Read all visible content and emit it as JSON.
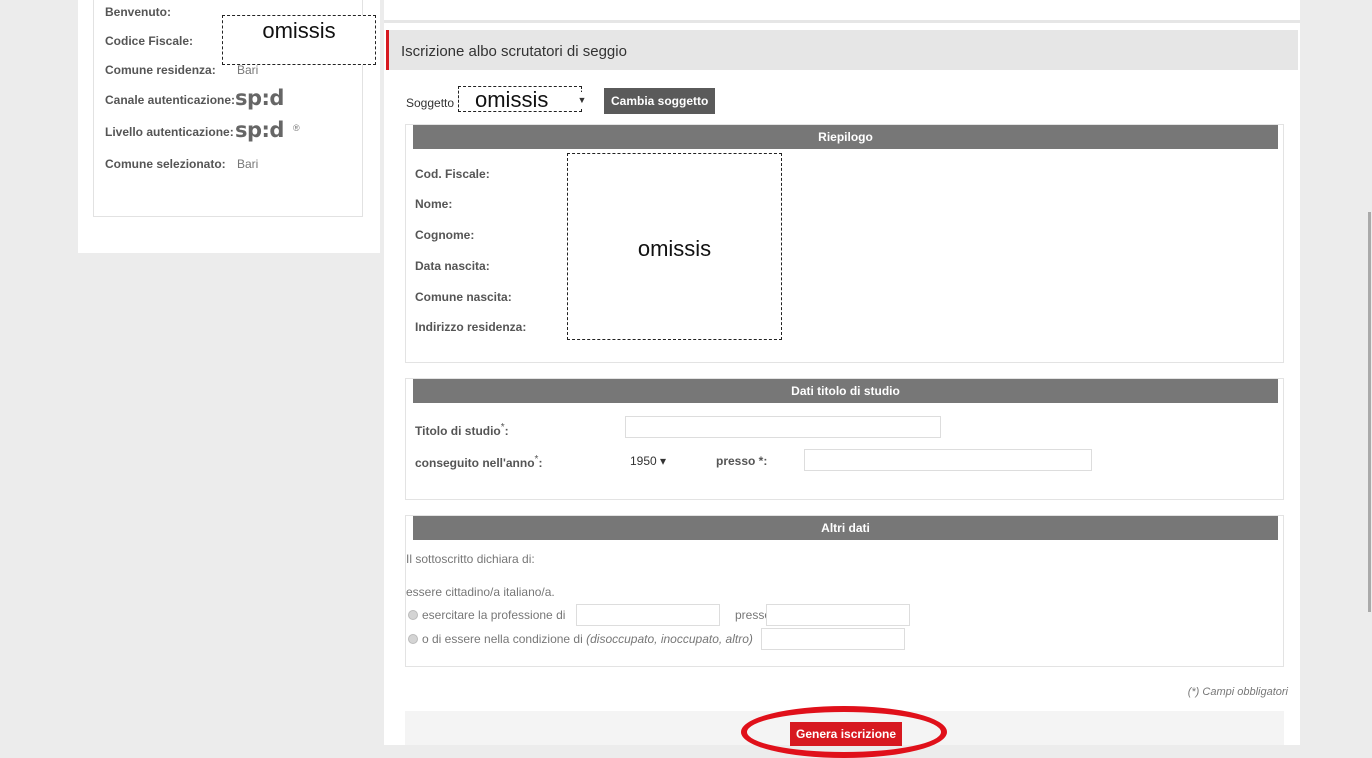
{
  "user_panel": {
    "benvenuto_label": "Benvenuto:",
    "codice_fiscale_label": "Codice Fiscale:",
    "comune_residenza_label": "Comune residenza:",
    "comune_residenza_value": "Bari",
    "canale_label": "Canale autenticazione:",
    "livello_label": "Livello autenticazione:",
    "spid_logo_text": "sp:d",
    "comune_selezionato_label": "Comune selezionato:",
    "comune_selezionato_value": "Bari",
    "redacted_text": "omissis"
  },
  "header": {
    "title": "Iscrizione albo scrutatori di seggio"
  },
  "soggetto": {
    "label": "Soggetto",
    "selected_value": "omissis",
    "change_button": "Cambia soggetto"
  },
  "riepilogo": {
    "heading": "Riepilogo",
    "fields": [
      "Cod. Fiscale:",
      "Nome:",
      "Cognome:",
      "Data nascita:",
      "Comune nascita:",
      "Indirizzo residenza:"
    ],
    "redacted_text": "omissis"
  },
  "titolo_studio": {
    "heading": "Dati titolo di studio",
    "titolo_label": "Titolo di studio",
    "anno_label": "conseguito nell'anno",
    "required_mark": "*",
    "anno_value": "1950 ▾",
    "presso_label": "presso *:",
    "titolo_suffix": ":"
  },
  "altri_dati": {
    "heading": "Altri dati",
    "intro": "Il sottoscritto dichiara di:",
    "cittadino": "essere cittadino/a italiano/a.",
    "professione": "esercitare la professione di",
    "presso": "presso",
    "condizione": "o di essere nella condizione di",
    "condizione_hint": "(disoccupato, inoccupato, altro)"
  },
  "footer": {
    "note": "(*) Campi obbligatori",
    "submit_button": "Genera iscrizione"
  },
  "colors": {
    "accent_red": "#d71920",
    "section_header_gray": "#777777"
  }
}
